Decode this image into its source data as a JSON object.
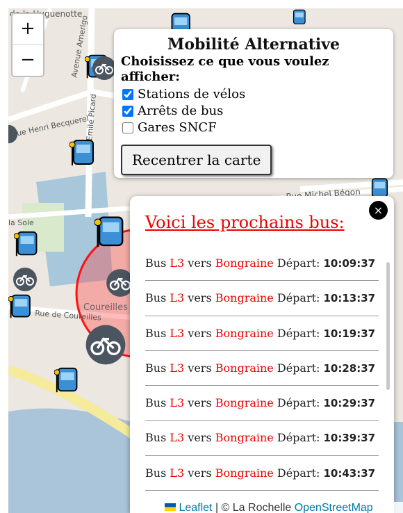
{
  "map": {
    "street_labels": [
      "de la Huguenotte",
      "Avenue Amerigo",
      "Rue Henri Becquerel",
      "Rue Emile Picard",
      "Rue Michel Bégon",
      "la Sole",
      "Rue de Coureilles",
      "Coureilles"
    ],
    "zoom_in": "+",
    "zoom_out": "−"
  },
  "panel": {
    "title": "Mobilité Alternative",
    "subtitle": "Choisissez ce que vous voulez afficher:",
    "options": [
      {
        "label": "Stations de vélos",
        "checked": true
      },
      {
        "label": "Arrêts de bus",
        "checked": true
      },
      {
        "label": "Gares SNCF",
        "checked": false
      }
    ],
    "recenter_label": "Recentrer la carte"
  },
  "popup": {
    "title": "Voici les prochains bus:",
    "close": "×",
    "rows": [
      {
        "prefix": "Bus",
        "line": "L3",
        "via": "vers",
        "dest": "Bongraine",
        "dep": "Départ:",
        "time": "10:09:37"
      },
      {
        "prefix": "Bus",
        "line": "L3",
        "via": "vers",
        "dest": "Bongraine",
        "dep": "Départ:",
        "time": "10:13:37"
      },
      {
        "prefix": "Bus",
        "line": "L3",
        "via": "vers",
        "dest": "Bongraine",
        "dep": "Départ:",
        "time": "10:19:37"
      },
      {
        "prefix": "Bus",
        "line": "L3",
        "via": "vers",
        "dest": "Bongraine",
        "dep": "Départ:",
        "time": "10:28:37"
      },
      {
        "prefix": "Bus",
        "line": "L3",
        "via": "vers",
        "dest": "Bongraine",
        "dep": "Départ:",
        "time": "10:29:37"
      },
      {
        "prefix": "Bus",
        "line": "L3",
        "via": "vers",
        "dest": "Bongraine",
        "dep": "Départ:",
        "time": "10:39:37"
      },
      {
        "prefix": "Bus",
        "line": "L3",
        "via": "vers",
        "dest": "Bongraine",
        "dep": "Départ:",
        "time": "10:43:37"
      }
    ]
  },
  "attribution": {
    "leaflet": "Leaflet",
    "sep": " | © La Rochelle ",
    "osm": "OpenStreetMap"
  },
  "colors": {
    "accent": "#e00000",
    "bus_marker": "#3a8fd6",
    "bike_marker": "#4a5560"
  }
}
